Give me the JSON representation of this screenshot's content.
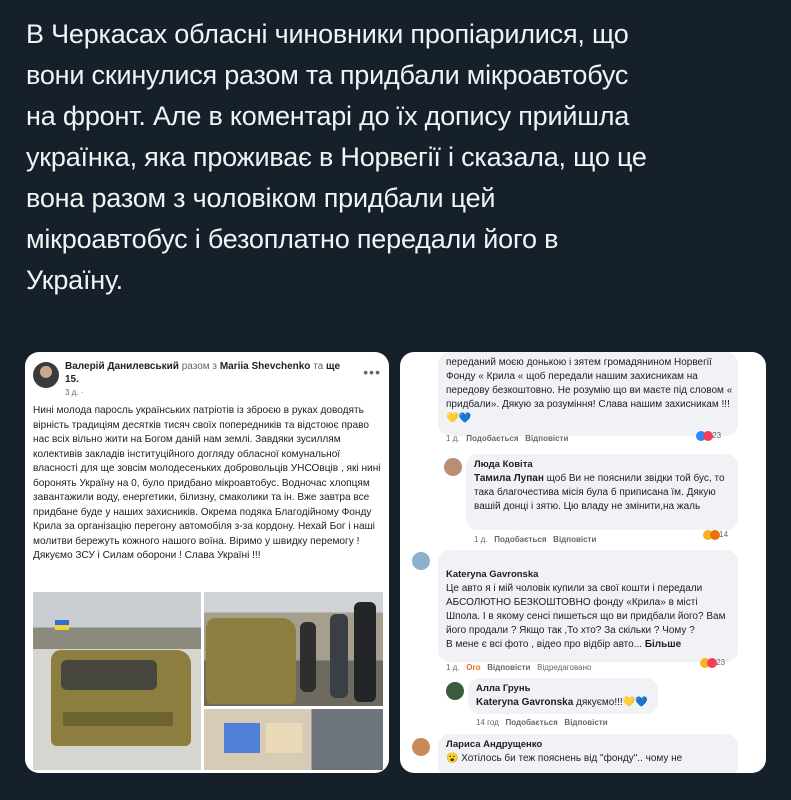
{
  "tweet": {
    "text": "В Черкасах обласні чиновники пропіарилися, що\nвони скинулися разом та придбали мікроавтобус\nна фронт. Але в коментарі до їх допису прийшла\nукраїнка, яка проживає в Норвегії і сказала, що це\nвона разом з чоловіком придбали цей\nмікроавтобус і безоплатно передали його в\nУкраїну."
  },
  "post": {
    "author": "Валерій Данилевський",
    "with_text": "разом з",
    "with_name": "Mariia Shevchenko",
    "and_text": "та",
    "and_more": "ще 15.",
    "time": "3 д. ·",
    "body": "Нині молода паросль українських патріотів із зброєю в руках доводять вірність традиціям десятків тисяч своїх попередників та відстоює право нас всіх вільно жити на Богом даній нам землі. Завдяки зусиллям колективів закладів інституційного догляду обласної комунальної власності для ще зовсім молодесеньких добровольців УНСОвців , які нині боронять Україну на 0, було придбано мікроавтобус. Водночас хлопцям завантажили воду, енергетики, білизну, смаколики та ін. Вже завтра все придбане буде у наших захисників. Окрема подяка Благодійному Фонду Крила за організацію перегону автомобіля з-за кордону. Нехай Бог і наші молитви бережуть кожного нашого воїна. Віримо у швидку перемогу ! Дякуємо ЗСУ і Силам оборони ! Слава Україні !!!"
  },
  "comments": {
    "c0": {
      "text": "переданий моєю донькою і зятем громадянином Норвегії Фонду « Крила « щоб передали нашим захисникам на передову безкоштовно. Не розумію що ви маєте під словом « придбали». Дякую за розуміння! Слава нашим захисникам !!!💛💙",
      "time": "1 д.",
      "like": "Подобається",
      "reply": "Відповісти",
      "reactions": "23"
    },
    "c1": {
      "name": "Люда Ковіта",
      "mention": "Тамила Лупан",
      "text": " щоб Ви не пояснили звідки той бус, то така благочестива місія була б приписана їм. Дякую вашій донці і зятю. Цю владу не змінити,на жаль",
      "time": "1 д.",
      "like": "Подобається",
      "reply": "Відповісти",
      "reactions": "14"
    },
    "c2": {
      "name": "Kateryna Gavronska",
      "text": "Це авто я і мій чоловік купили за свої кошти і передали АБСОЛЮТНО БЕЗКОШТОВНО фонду «Крила» в місті Шпола. І в якому сенсі пишеться що ви придбали його? Вам його продали ? Якщо так ,То хто? За скільки ? Чому ?\nВ мене є всі фото , відео про відбір авто...",
      "more": "Більше",
      "time": "1 д.",
      "like": "Ого",
      "reply": "Відповісти",
      "edited": "Відредаговано",
      "reactions": "23"
    },
    "c3": {
      "name": "Алла Грунь",
      "mention": "Kateryna Gavronska",
      "text": " дякуємо!!!💛💙",
      "time": "14 год",
      "like": "Подобається",
      "reply": "Відповісти"
    },
    "c4": {
      "name": "Лариса Андрущенко",
      "text": "😮 Хотілось би теж пояснень від \"фонду\".. чому не"
    }
  },
  "colors": {
    "background": "#15202b",
    "tweet_text": "#f1f3f5",
    "fb_gray": "#65676b",
    "wow": "#e9710f"
  }
}
